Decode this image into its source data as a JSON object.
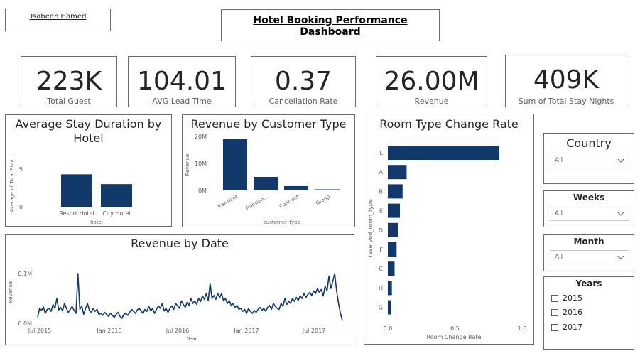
{
  "author": "Tsabeeh Hamed",
  "title": "Hotel Booking Performance Dashboard",
  "kpis": [
    {
      "value": "223K",
      "label": "Total Guest"
    },
    {
      "value": "104.01",
      "label": "AVG Lead Time"
    },
    {
      "value": "0.37",
      "label": "Cancellation Rate"
    },
    {
      "value": "26.00M",
      "label": "Revenue"
    },
    {
      "value": "409K",
      "label": "Sum of Total Stay Nights"
    }
  ],
  "colors": {
    "bar": "#12396b",
    "axis_text": "#605e5c",
    "border": "#6b6b6b"
  },
  "slicers": {
    "country": {
      "title": "Country",
      "value": "All",
      "icon": "chevron-down-icon"
    },
    "weeks": {
      "title": "Weeks",
      "value": "All",
      "icon": "chevron-down-icon"
    },
    "month": {
      "title": "Month",
      "value": "All",
      "icon": "chevron-down-icon"
    },
    "years": {
      "title": "Years",
      "options": [
        "2015",
        "2016",
        "2017"
      ]
    }
  },
  "chart_data": [
    {
      "type": "bar",
      "title": "Average Stay Duration by Hotel",
      "xlabel": "hotel",
      "ylabel": "Average of Total Stay ...",
      "categories": [
        "Resort Hotel",
        "City Hotel"
      ],
      "values": [
        4.3,
        3.0
      ],
      "yticks": [
        "0",
        "5"
      ],
      "ylim": [
        0,
        6.5
      ]
    },
    {
      "type": "bar",
      "title": "Revenue by Customer Type",
      "xlabel": "customer_type",
      "ylabel": "Revenue",
      "categories": [
        "Transient",
        "Transien...",
        "Contract",
        "Group"
      ],
      "values": [
        19.0,
        5.0,
        1.6,
        0.4
      ],
      "yticks": [
        "20M",
        "10M",
        "0M"
      ],
      "ylim": [
        0,
        20
      ]
    },
    {
      "type": "bar",
      "title": "Room Type Change Rate",
      "xlabel": "Room Change Rate",
      "ylabel": "reserved_room_type",
      "categories": [
        "L",
        "A",
        "B",
        "E",
        "D",
        "F",
        "C",
        "H",
        "G"
      ],
      "values": [
        0.83,
        0.14,
        0.11,
        0.09,
        0.075,
        0.065,
        0.05,
        0.03,
        0.025
      ],
      "xticks": [
        "0.0",
        "0.5",
        "1.0"
      ],
      "xlim": [
        0,
        1.0
      ]
    },
    {
      "type": "line",
      "title": "Revenue by Date",
      "xlabel": "Year",
      "ylabel": "Revenue",
      "xticks": [
        "Jul 2015",
        "Jan 2016",
        "Jul 2016",
        "Jan 2017",
        "Jul 2017"
      ],
      "yticks": [
        "0.1M",
        "0.0M"
      ],
      "ylim": [
        0,
        0.12
      ],
      "series": [
        {
          "values": [
            0.012,
            0.03,
            0.026,
            0.033,
            0.02,
            0.028,
            0.03,
            0.024,
            0.038,
            0.03,
            0.05,
            0.027,
            0.032,
            0.025,
            0.04,
            0.03,
            0.022,
            0.028,
            0.034,
            0.026,
            0.02,
            0.1,
            0.028,
            0.035,
            0.018,
            0.03,
            0.04,
            0.026,
            0.022,
            0.03,
            0.024,
            0.028,
            0.018,
            0.02,
            0.016,
            0.022,
            0.018,
            0.014,
            0.02,
            0.016,
            0.012,
            0.018,
            0.022,
            0.014,
            0.01,
            0.018,
            0.02,
            0.016,
            0.022,
            0.028,
            0.024,
            0.02,
            0.027,
            0.03,
            0.025,
            0.02,
            0.028,
            0.024,
            0.034,
            0.025,
            0.03,
            0.02,
            0.028,
            0.035,
            0.03,
            0.04,
            0.025,
            0.03,
            0.022,
            0.03,
            0.035,
            0.028,
            0.04,
            0.035,
            0.03,
            0.045,
            0.038,
            0.032,
            0.042,
            0.036,
            0.05,
            0.04,
            0.045,
            0.038,
            0.05,
            0.044,
            0.055,
            0.048,
            0.06,
            0.045,
            0.08,
            0.05,
            0.056,
            0.048,
            0.06,
            0.052,
            0.06,
            0.045,
            0.05,
            0.04,
            0.046,
            0.035,
            0.04,
            0.032,
            0.036,
            0.028,
            0.03,
            0.024,
            0.028,
            0.02,
            0.03,
            0.024,
            0.02,
            0.026,
            0.022,
            0.028,
            0.032,
            0.026,
            0.03,
            0.024,
            0.032,
            0.036,
            0.028,
            0.04,
            0.034,
            0.03,
            0.028,
            0.04,
            0.034,
            0.05,
            0.038,
            0.044,
            0.04,
            0.05,
            0.044,
            0.052,
            0.046,
            0.055,
            0.05,
            0.06,
            0.052,
            0.058,
            0.062,
            0.056,
            0.065,
            0.06,
            0.07,
            0.062,
            0.068,
            0.055,
            0.075,
            0.065,
            0.095,
            0.07,
            0.085,
            0.1,
            0.065,
            0.04,
            0.02,
            0.005
          ]
        }
      ]
    }
  ]
}
